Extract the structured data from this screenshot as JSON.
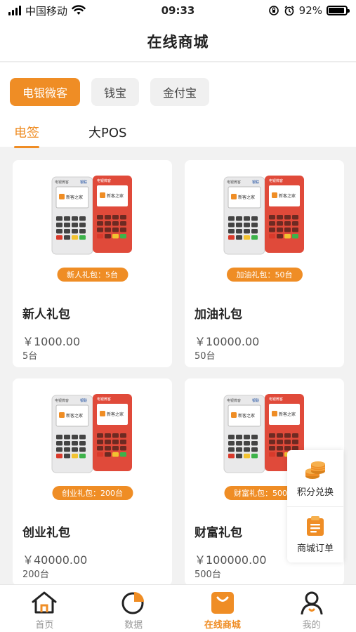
{
  "status_bar": {
    "carrier": "中国移动",
    "time": "09:33",
    "battery": "92%",
    "battery_level": 0.92
  },
  "header": {
    "title": "在线商城"
  },
  "filters": {
    "chips": [
      "电银微客",
      "钱宝",
      "金付宝"
    ],
    "active_chip": 0,
    "subtabs": [
      "电签",
      "大POS"
    ],
    "active_subtab": 0
  },
  "products": [
    {
      "badge": "新人礼包：5台",
      "name": "新人礼包",
      "price": "￥1000.00",
      "qty": "5台"
    },
    {
      "badge": "加油礼包：50台",
      "name": "加油礼包",
      "price": "￥10000.00",
      "qty": "50台"
    },
    {
      "badge": "创业礼包：200台",
      "name": "创业礼包",
      "price": "￥40000.00",
      "qty": "200台"
    },
    {
      "badge": "财富礼包：500台",
      "name": "财富礼包",
      "price": "￥100000.00",
      "qty": "500台"
    }
  ],
  "device_screen_text": [
    "电银微客",
    "银联",
    "新客之家"
  ],
  "float_panel": [
    {
      "label": "积分兑换",
      "icon": "coins-icon"
    },
    {
      "label": "商城订单",
      "icon": "order-list-icon"
    }
  ],
  "tab_bar": [
    {
      "label": "首页",
      "icon": "home-icon"
    },
    {
      "label": "数据",
      "icon": "pie-chart-icon"
    },
    {
      "label": "在线商城",
      "icon": "shopping-bag-icon"
    },
    {
      "label": "我的",
      "icon": "user-icon"
    }
  ],
  "active_tab": 2,
  "colors": {
    "accent": "#ef8d25",
    "background": "#f2f2f2",
    "inactive": "#999999",
    "device_red": "#e04a3a"
  }
}
